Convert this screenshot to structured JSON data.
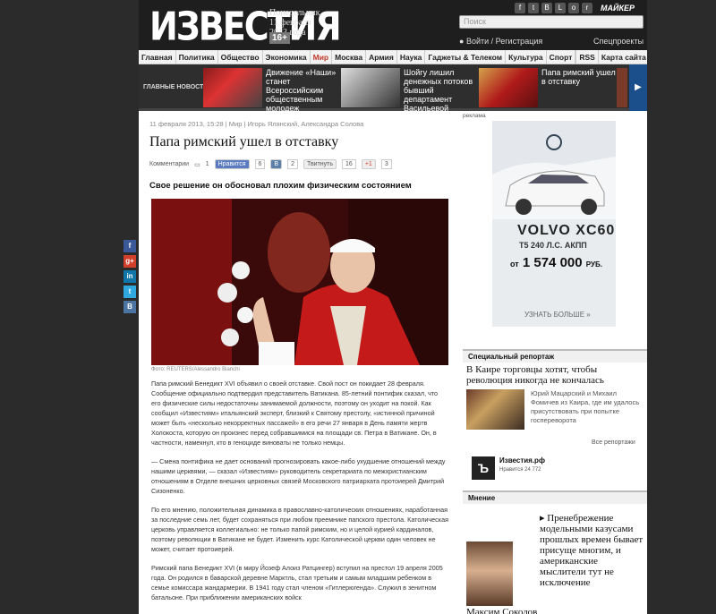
{
  "header": {
    "logo": "ИЗВЕСТИЯ",
    "date_line1": "Понедельник,",
    "date_line2": "11 февраля",
    "date_line3": "2013 года",
    "age": "16+",
    "maker": "МАЙКЕР",
    "search_placeholder": "Поиск",
    "login": "Войти / Регистрация",
    "special": "Спецпроекты"
  },
  "nav": {
    "items": [
      "Главная",
      "Политика",
      "Общество",
      "Экономика",
      "Мир",
      "Москва",
      "Армия",
      "Наука",
      "Гаджеты & Телеком",
      "Культура",
      "Спорт"
    ],
    "active": "Мир",
    "rss": "RSS",
    "sitemap": "Карта сайта"
  },
  "main_news": {
    "label": "ГЛАВНЫЕ НОВОСТИ",
    "items": [
      {
        "text": "Движение «Наши» станет Всероссийским общественным молодеж"
      },
      {
        "text": "Шойгу лишил денежных потоков бывший департамент Васильевой"
      },
      {
        "text": "Папа римский ушел в отставку"
      }
    ]
  },
  "article": {
    "meta": "11 февраля 2013, 15:28  |  Мир  |  Игорь Ялянский, Александра Солова",
    "title": "Папа римский ушел в отставку",
    "comments_label": "Комментарии",
    "comments_count": "1",
    "like_label": "Нравится",
    "like_count": "6",
    "vk_label": "В",
    "vk_count": "2",
    "twitter_label": "Твитнуть",
    "twitter_count": "16",
    "gplus_label": "+1",
    "gplus_count": "3",
    "lead": "Свое решение он обосновал плохим физическим состоянием",
    "photo_caption": "Фото: REUTERS/Alessandro Bianchi",
    "paragraphs": [
      "Папа римский Бенедикт XVI объявил о своей отставке. Свой пост он покидает 28 февраля. Сообщение официально подтвердил представитель Ватикана. 85-летний понтифик сказал, что его физические силы недостаточны занимаемой должности, поэтому он уходит на покой. Как сообщил «Известиям» итальянский эксперт, близкий к Святому престолу, «истинной причиной может быть «несколько некорректных пассажей» в его речи 27 января в День памяти жертв Холокоста, которую он произнес перед собравшимися на площади св. Петра в Ватикане. Он, в частности, намекнул, кто в геноциде виноваты не только немцы.",
      "— Смена понтифика не дает оснований прогнозировать какое-либо ухудшение отношений между нашими церквями, — сказал «Известиям» руководитель секретариата по межхристианским отношениям в Отделе внешних церковных связей Московского патриархата протоиерей Дмитрий Сизоненко.",
      "По его мнению, положительная динамика в православно-католических отношениях, наработанная за последние семь лет, будет сохраняться при любом преемнике папского престола. Католическая церковь управляется коллегиально: не только папой римским, но и целой курией кардиналов, поэтому революции в Ватикане не будет. Изменить курс Католической церкви один человек не может, считает протоиерей.",
      "Римский папа Бенедикт XVI (в миру Йозеф Алоиз Ратцингер) вступил на престол 19 апреля 2005 года. Он родился в баварской деревне Марктль, стал третьим и самым младшим ребенком в семье комиссара жандармерии. В 1941 году стал членом «Гитлерюгенда». Служил в зенитном батальоне. При приближении американских войск"
    ]
  },
  "ad": {
    "label": "реклама",
    "brand": "VOLVO XC60",
    "spec": "T5 240 Л.С. АКПП",
    "price_prefix": "от",
    "price": "1 574 000",
    "currency": "РУБ.",
    "more": "УЗНАТЬ БОЛЬШЕ"
  },
  "special_report": {
    "heading": "Специальный репортаж",
    "title": "В Каире торговцы хотят, чтобы революция никогда не кончалась",
    "text": "Юрий Мацарский и Михаил Фомичев из Каира, где им удалось присутствовать при попытке госпереворота",
    "all": "Все репортажи"
  },
  "izv_widget": {
    "logo": "Ъ",
    "name": "Известия.рф",
    "like_text": "Нравится",
    "count": "24 772"
  },
  "opinion": {
    "heading": "Мнение",
    "text": "Пренебрежение модельными казусами прошлых времен бывает присуще многим, и американские мыслители тут не исключение",
    "author": "Максим Соколов"
  },
  "float_social": [
    "f",
    "g+",
    "in",
    "t",
    "В"
  ],
  "colors": {
    "page_bg": "#2b2b2b",
    "header_bg": "#1e1e1e",
    "accent_red": "#c0392b",
    "strip_blue": "#1a4f8c"
  }
}
